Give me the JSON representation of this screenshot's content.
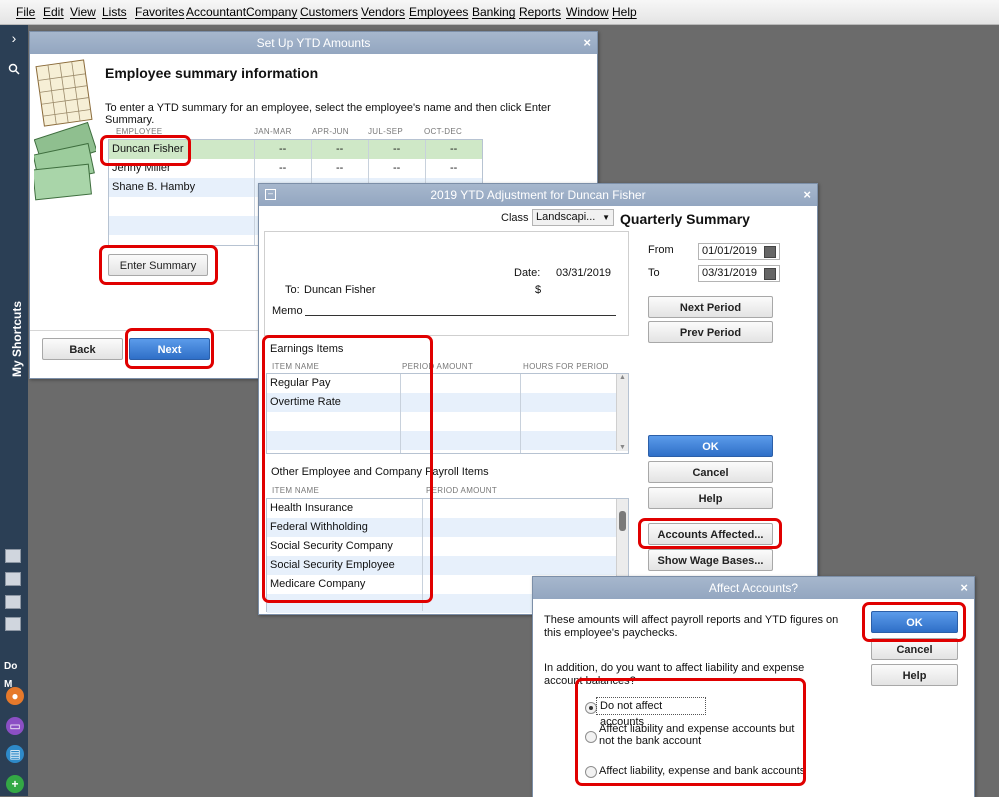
{
  "menu": [
    "File",
    "Edit",
    "View",
    "Lists",
    "Favorites",
    "Accountant",
    "Company",
    "Customers",
    "Vendors",
    "Employees",
    "Banking",
    "Reports",
    "Window",
    "Help"
  ],
  "sidebar": {
    "shortcuts_label": "My Shortcuts",
    "do_more_label": "Do M"
  },
  "ytd_setup": {
    "title": "Set Up YTD Amounts",
    "heading": "Employee summary information",
    "instruction": "To enter a YTD summary for an employee, select the employee's name and then click Enter Summary.",
    "columns": [
      "EMPLOYEE",
      "JAN-MAR",
      "APR-JUN",
      "JUL-SEP",
      "OCT-DEC"
    ],
    "employees": [
      "Duncan Fisher",
      "Jenny Miller",
      "Shane B. Hamby"
    ],
    "quarter_placeholder": "--",
    "enter_summary": "Enter Summary",
    "back": "Back",
    "next": "Next"
  },
  "adjustment": {
    "title": "2019 YTD Adjustment for Duncan Fisher",
    "class_label": "Class",
    "class_value": "Landscapi...",
    "summary_heading": "Quarterly Summary",
    "date_label": "Date:",
    "date_value": "03/31/2019",
    "to_label": "To:",
    "to_value": "Duncan Fisher",
    "dollar": "$",
    "memo_label": "Memo",
    "from_label": "From",
    "from_value": "01/01/2019",
    "to_date_label": "To",
    "to_date_value": "03/31/2019",
    "next_period": "Next Period",
    "prev_period": "Prev Period",
    "ok": "OK",
    "cancel": "Cancel",
    "help": "Help",
    "accounts_affected": "Accounts Affected...",
    "show_wage_bases": "Show Wage Bases...",
    "earnings_heading": "Earnings Items",
    "earnings_columns": [
      "ITEM NAME",
      "PERIOD AMOUNT",
      "HOURS FOR PERIOD"
    ],
    "earnings_items": [
      "Regular Pay",
      "Overtime Rate"
    ],
    "other_heading": "Other Employee and Company Payroll Items",
    "other_columns": [
      "ITEM NAME",
      "PERIOD AMOUNT"
    ],
    "other_items": [
      "Health Insurance",
      "Federal Withholding",
      "Social Security Company",
      "Social Security Employee",
      "Medicare Company"
    ]
  },
  "affect": {
    "title": "Affect Accounts?",
    "text1": "These amounts will affect payroll reports and YTD figures on this employee's paychecks.",
    "text2": "In addition, do you want to affect liability and expense account balances?",
    "options": [
      "Do not affect accounts",
      "Affect liability and expense accounts but not the bank account",
      "Affect liability, expense and bank accounts"
    ],
    "selected_option": "Do not affect accounts",
    "ok": "OK",
    "cancel": "Cancel",
    "help": "Help"
  },
  "colors": {
    "highlight": "#e00000",
    "primary_button": "#2f6fc7",
    "selected_row": "#cfe8c7",
    "titlebar": "#9aadc6"
  }
}
